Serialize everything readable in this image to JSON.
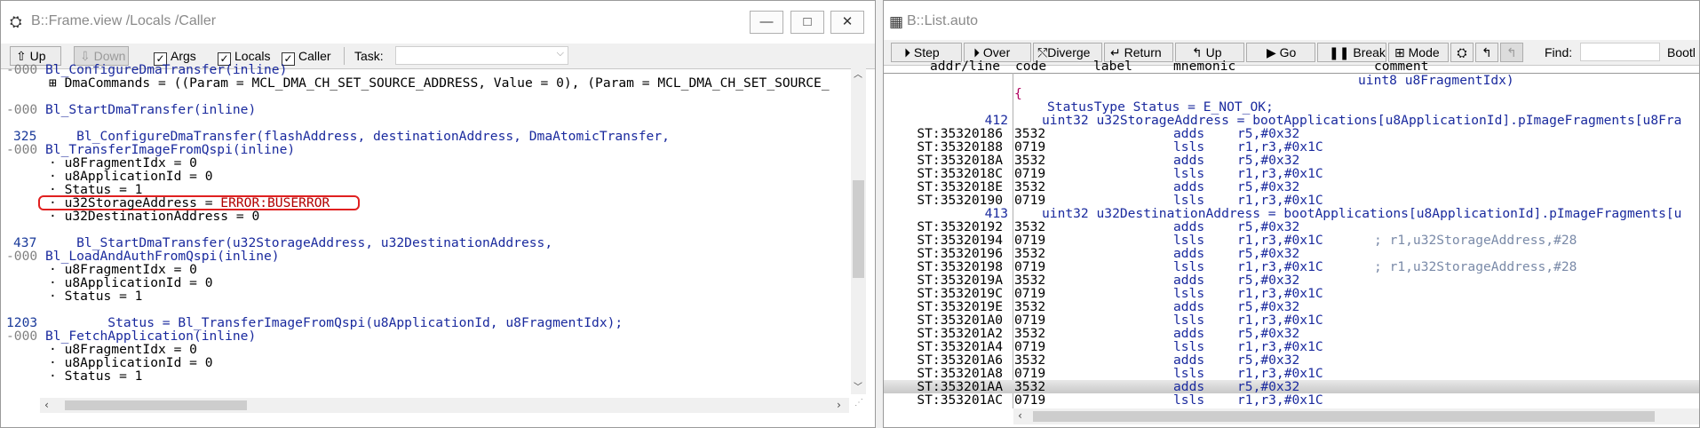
{
  "left_window": {
    "title": "B::Frame.view /Locals /Caller",
    "buttons": {
      "minimize": "—",
      "maximize": "□",
      "close": "✕"
    },
    "toolbar": {
      "up_label": "Up",
      "down_label": "Down",
      "args_label": "Args",
      "locals_label": "Locals",
      "caller_label": "Caller",
      "task_label": "Task:",
      "task_value": ""
    },
    "lines": [
      {
        "num": "-000",
        "text": "Bl_ConfigureDmaTransfer(inline)",
        "kind": "func"
      },
      {
        "num": "",
        "text": "⊞ DmaCommands = ((Param = MCL_DMA_CH_SET_SOURCE_ADDRESS, Value = 0), (Param = MCL_DMA_CH_SET_SOURCE_",
        "kind": "var"
      },
      {
        "num": "",
        "text": "",
        "kind": "blank"
      },
      {
        "num": "-000",
        "text": "Bl_StartDmaTransfer(inline)",
        "kind": "func"
      },
      {
        "num": "",
        "text": "",
        "kind": "blank"
      },
      {
        "num": "325",
        "text": "    Bl_ConfigureDmaTransfer(flashAddress, destinationAddress, DmaAtomicTransfer,",
        "kind": "src"
      },
      {
        "num": "-000",
        "text": "Bl_TransferImageFromQspi(inline)",
        "kind": "func"
      },
      {
        "num": "",
        "text": "· u8FragmentIdx = 0",
        "kind": "var"
      },
      {
        "num": "",
        "text": "· u8ApplicationId = 0",
        "kind": "var"
      },
      {
        "num": "",
        "text": "· Status = 1",
        "kind": "var"
      },
      {
        "num": "",
        "text": "· u32StorageAddress = ",
        "err": "ERROR:BUSERROR",
        "kind": "error"
      },
      {
        "num": "",
        "text": "· u32DestinationAddress = 0",
        "kind": "var"
      },
      {
        "num": "",
        "text": "",
        "kind": "blank"
      },
      {
        "num": "437",
        "text": "    Bl_StartDmaTransfer(u32StorageAddress, u32DestinationAddress,",
        "kind": "src"
      },
      {
        "num": "-000",
        "text": "Bl_LoadAndAuthFromQspi(inline)",
        "kind": "func"
      },
      {
        "num": "",
        "text": "· u8FragmentIdx = 0",
        "kind": "var"
      },
      {
        "num": "",
        "text": "· u8ApplicationId = 0",
        "kind": "var"
      },
      {
        "num": "",
        "text": "· Status = 1",
        "kind": "var"
      },
      {
        "num": "",
        "text": "",
        "kind": "blank"
      },
      {
        "num": "1203",
        "text": "        Status = Bl_TransferImageFromQspi(u8ApplicationId, u8FragmentIdx);",
        "kind": "src"
      },
      {
        "num": "-000",
        "text": "Bl_FetchApplication(inline)",
        "kind": "func"
      },
      {
        "num": "",
        "text": "· u8FragmentIdx = 0",
        "kind": "var"
      },
      {
        "num": "",
        "text": "· u8ApplicationId = 0",
        "kind": "var"
      },
      {
        "num": "",
        "text": "· Status = 1",
        "kind": "var"
      }
    ]
  },
  "right_window": {
    "title": "B::List.auto",
    "toolbar": {
      "step": "Step",
      "over": "Over",
      "diverge": "Diverge",
      "return": "Return",
      "up": "Up",
      "go": "Go",
      "break": "Break",
      "mode": "Mode",
      "find": "Find:",
      "find_value": "",
      "bootl": "Bootl"
    },
    "columns": [
      "addr/line",
      "code",
      "label",
      "mnemonic",
      "comment"
    ],
    "rows": [
      {
        "type": "src",
        "num": "",
        "text": "uint8 u8FragmentIdx)"
      },
      {
        "type": "brace",
        "num": "",
        "text": "{"
      },
      {
        "type": "src2",
        "num": "",
        "text": "StatusType Status = E_NOT_OK;"
      },
      {
        "type": "src",
        "num": "412",
        "text": "uint32 u32StorageAddress = bootApplications[u8ApplicationId].pImageFragments[u8Fra"
      },
      {
        "type": "asm",
        "addr": "ST:35320186",
        "code": "3532",
        "mn": "adds",
        "op": "r5,#0x32",
        "cm": ""
      },
      {
        "type": "asm",
        "addr": "ST:35320188",
        "code": "0719",
        "mn": "lsls",
        "op": "r1,r3,#0x1C",
        "cm": ""
      },
      {
        "type": "asm",
        "addr": "ST:3532018A",
        "code": "3532",
        "mn": "adds",
        "op": "r5,#0x32",
        "cm": ""
      },
      {
        "type": "asm",
        "addr": "ST:3532018C",
        "code": "0719",
        "mn": "lsls",
        "op": "r1,r3,#0x1C",
        "cm": ""
      },
      {
        "type": "asm",
        "addr": "ST:3532018E",
        "code": "3532",
        "mn": "adds",
        "op": "r5,#0x32",
        "cm": ""
      },
      {
        "type": "asm",
        "addr": "ST:35320190",
        "code": "0719",
        "mn": "lsls",
        "op": "r1,r3,#0x1C",
        "cm": ""
      },
      {
        "type": "src",
        "num": "413",
        "text": "uint32 u32DestinationAddress = bootApplications[u8ApplicationId].pImageFragments[u"
      },
      {
        "type": "asm",
        "addr": "ST:35320192",
        "code": "3532",
        "mn": "adds",
        "op": "r5,#0x32",
        "cm": ""
      },
      {
        "type": "asm",
        "addr": "ST:35320194",
        "code": "0719",
        "mn": "lsls",
        "op": "r1,r3,#0x1C",
        "cm": "; r1,u32StorageAddress,#28"
      },
      {
        "type": "asm",
        "addr": "ST:35320196",
        "code": "3532",
        "mn": "adds",
        "op": "r5,#0x32",
        "cm": ""
      },
      {
        "type": "asm",
        "addr": "ST:35320198",
        "code": "0719",
        "mn": "lsls",
        "op": "r1,r3,#0x1C",
        "cm": "; r1,u32StorageAddress,#28"
      },
      {
        "type": "asm",
        "addr": "ST:3532019A",
        "code": "3532",
        "mn": "adds",
        "op": "r5,#0x32",
        "cm": ""
      },
      {
        "type": "asm",
        "addr": "ST:3532019C",
        "code": "0719",
        "mn": "lsls",
        "op": "r1,r3,#0x1C",
        "cm": ""
      },
      {
        "type": "asm",
        "addr": "ST:3532019E",
        "code": "3532",
        "mn": "adds",
        "op": "r5,#0x32",
        "cm": ""
      },
      {
        "type": "asm",
        "addr": "ST:353201A0",
        "code": "0719",
        "mn": "lsls",
        "op": "r1,r3,#0x1C",
        "cm": ""
      },
      {
        "type": "asm",
        "addr": "ST:353201A2",
        "code": "3532",
        "mn": "adds",
        "op": "r5,#0x32",
        "cm": ""
      },
      {
        "type": "asm",
        "addr": "ST:353201A4",
        "code": "0719",
        "mn": "lsls",
        "op": "r1,r3,#0x1C",
        "cm": ""
      },
      {
        "type": "asm",
        "addr": "ST:353201A6",
        "code": "3532",
        "mn": "adds",
        "op": "r5,#0x32",
        "cm": ""
      },
      {
        "type": "asm",
        "addr": "ST:353201A8",
        "code": "0719",
        "mn": "lsls",
        "op": "r1,r3,#0x1C",
        "cm": ""
      },
      {
        "type": "asm",
        "addr": "ST:353201AA",
        "code": "3532",
        "mn": "adds",
        "op": "r5,#0x32",
        "cm": "",
        "current": true
      },
      {
        "type": "asm",
        "addr": "ST:353201AC",
        "code": "0719",
        "mn": "lsls",
        "op": "r1,r3,#0x1C",
        "cm": ""
      }
    ]
  }
}
